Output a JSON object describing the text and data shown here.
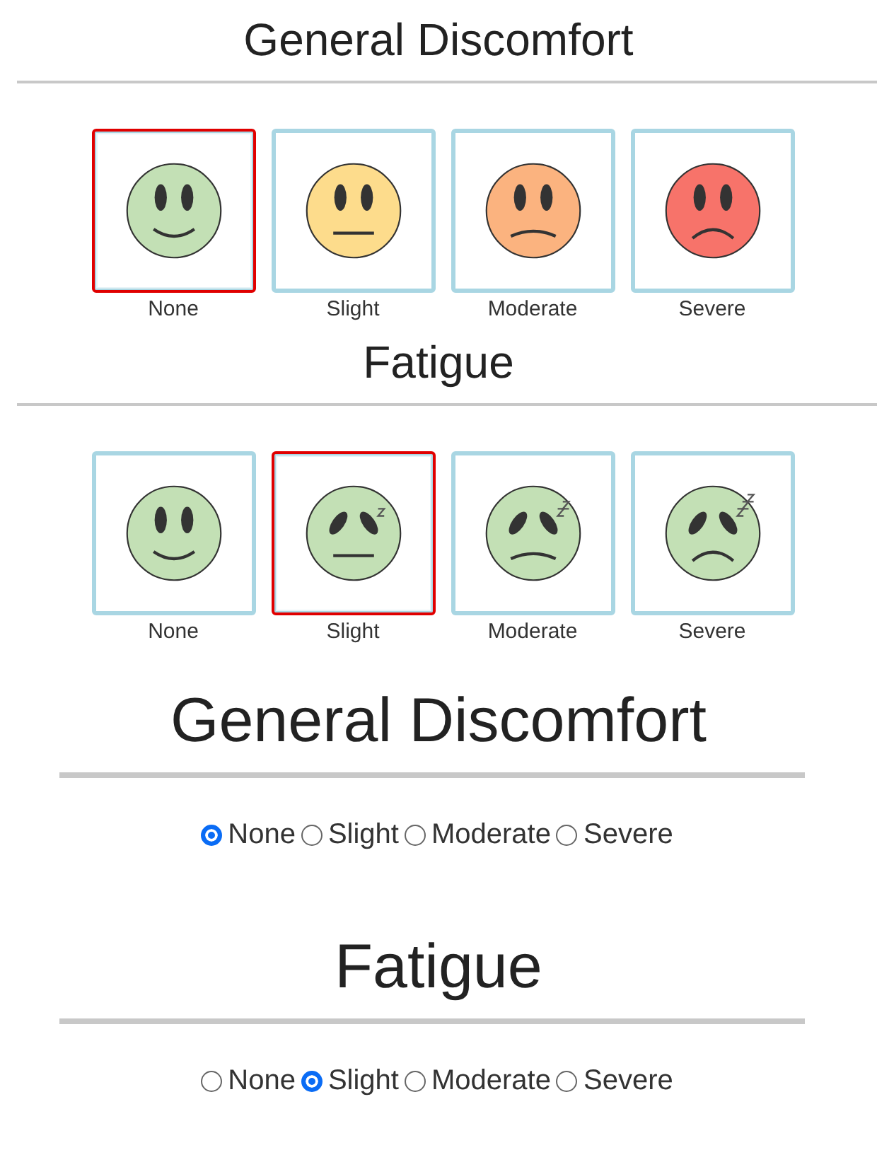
{
  "face_scales": [
    {
      "title": "General Discomfort",
      "kind": "discomfort",
      "options": [
        {
          "label": "None",
          "selected": true,
          "color": "#c3e0b5"
        },
        {
          "label": "Slight",
          "selected": false,
          "color": "#fddc8c"
        },
        {
          "label": "Moderate",
          "selected": false,
          "color": "#fbb37f"
        },
        {
          "label": "Severe",
          "selected": false,
          "color": "#f7736a"
        }
      ]
    },
    {
      "title": "Fatigue",
      "kind": "fatigue",
      "options": [
        {
          "label": "None",
          "selected": false
        },
        {
          "label": "Slight",
          "selected": true
        },
        {
          "label": "Moderate",
          "selected": false
        },
        {
          "label": "Severe",
          "selected": false
        }
      ]
    }
  ],
  "radio_groups": [
    {
      "title": "General Discomfort",
      "options": [
        {
          "label": "None",
          "selected": true
        },
        {
          "label": "Slight",
          "selected": false
        },
        {
          "label": "Moderate",
          "selected": false
        },
        {
          "label": "Severe",
          "selected": false
        }
      ]
    },
    {
      "title": "Fatigue",
      "options": [
        {
          "label": "None",
          "selected": false
        },
        {
          "label": "Slight",
          "selected": true
        },
        {
          "label": "Moderate",
          "selected": false
        },
        {
          "label": "Severe",
          "selected": false
        }
      ]
    }
  ]
}
